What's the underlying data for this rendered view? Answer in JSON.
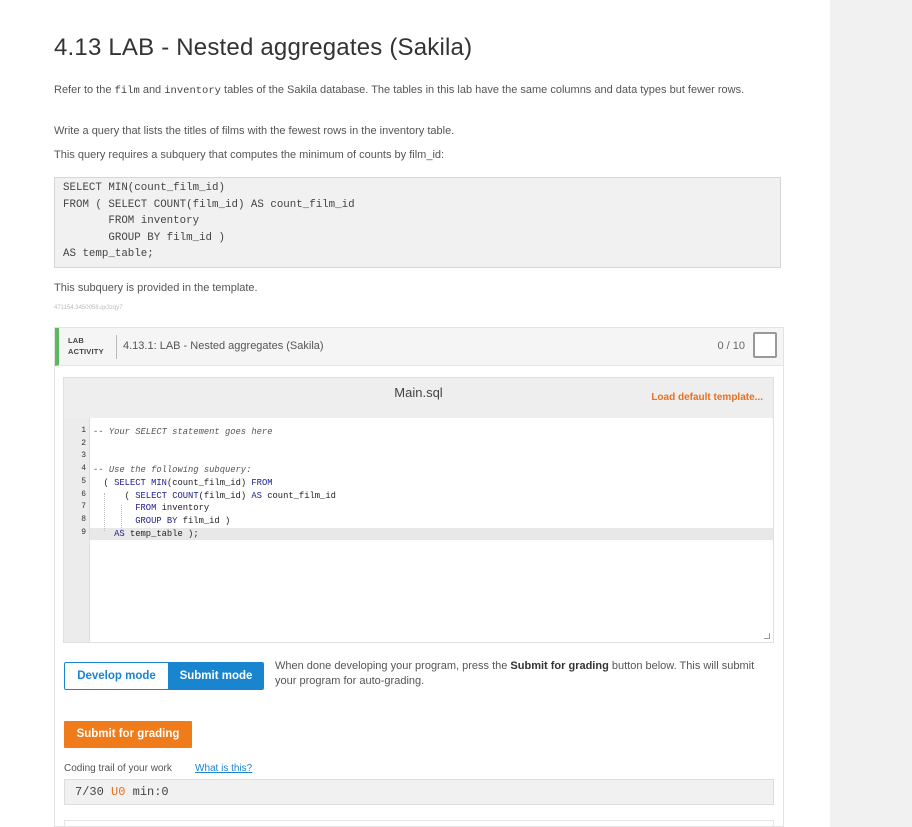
{
  "page": {
    "title": "4.13 LAB - Nested aggregates (Sakila)",
    "intro": {
      "before": "Refer to the ",
      "code1": "film",
      "middle": " and ",
      "code2": "inventory",
      "after": " tables of the Sakila database. The tables in this lab have the same columns and data types but fewer rows."
    },
    "task": "Write a query that lists the titles of films with the fewest rows in the inventory table.",
    "hint": "This query requires a subquery that computes the minimum of counts by film_id:",
    "example_query": "SELECT MIN(count_film_id)\nFROM ( SELECT COUNT(film_id) AS count_film_id\n       FROM inventory\n       GROUP BY film_id )\nAS temp_table;",
    "provided_note": "This subquery is provided in the template.",
    "hash": "471154.3450058.qx3zqy7"
  },
  "lab": {
    "tag_line1": "LAB",
    "tag_line2": "ACTIVITY",
    "title": "4.13.1: LAB - Nested aggregates (Sakila)",
    "score": "0 / 10",
    "editor": {
      "file_name": "Main.sql",
      "load_template": "Load default template...",
      "line_numbers": [
        "1",
        "2",
        "3",
        "4",
        "5",
        "6",
        "7",
        "8",
        "9"
      ],
      "lines": [
        "-- Your SELECT statement goes here",
        "",
        "",
        "-- Use the following subquery:",
        "  ( SELECT MIN(count_film_id) FROM",
        "      ( SELECT COUNT(film_id) AS count_film_id",
        "        FROM inventory",
        "        GROUP BY film_id )",
        "    AS temp_table );"
      ]
    },
    "mode": {
      "develop": "Develop mode",
      "submit": "Submit mode",
      "desc_before": "When done developing your program, press the ",
      "desc_bold": "Submit for grading",
      "desc_after": " button below. This will submit your program for auto-grading."
    },
    "submit_button": "Submit for grading",
    "trail_label": "Coding trail of your work",
    "trail_link": "What is this?",
    "trail": {
      "prefix": "7/30 ",
      "u": "U0",
      "suffix": " min:0"
    }
  }
}
